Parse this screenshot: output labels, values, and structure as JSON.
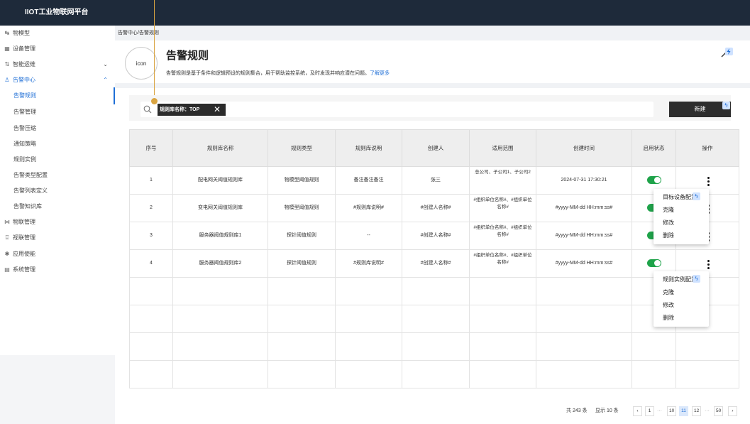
{
  "app": {
    "title": "IIOT工业物联网平台"
  },
  "sidebar": {
    "items": [
      {
        "icon": "model-icon",
        "glyph": "↹",
        "label": "物模型",
        "chevron": ""
      },
      {
        "icon": "device-icon",
        "glyph": "▦",
        "label": "设备管理",
        "chevron": ""
      },
      {
        "icon": "ops-icon",
        "glyph": "⇅",
        "label": "智能运维",
        "chevron": "⌄"
      },
      {
        "icon": "alarm-icon",
        "glyph": "♙",
        "label": "告警中心",
        "chevron": "⌃"
      },
      {
        "label": "告警规则",
        "sub": true
      },
      {
        "label": "告警管理",
        "sub": true
      },
      {
        "label": "告警压缩",
        "sub": true
      },
      {
        "label": "通知策略",
        "sub": true
      },
      {
        "label": "规则实例",
        "sub": true
      },
      {
        "label": "告警类型配置",
        "sub": true
      },
      {
        "label": "告警列表定义",
        "sub": true
      },
      {
        "label": "告警知识库",
        "sub": true
      },
      {
        "icon": "iot-icon",
        "glyph": "⋈",
        "label": "物联管理",
        "chevron": ""
      },
      {
        "icon": "video-icon",
        "glyph": "⍗",
        "label": "视联管理",
        "chevron": ""
      },
      {
        "icon": "app-icon",
        "glyph": "✱",
        "label": "应用使能",
        "chevron": ""
      },
      {
        "icon": "system-icon",
        "glyph": "▤",
        "label": "系统管理",
        "chevron": ""
      }
    ]
  },
  "breadcrumb": "告警中心/告警规则",
  "header": {
    "avatar": "icon",
    "title": "告警规则",
    "description": "告警规则是基于条件和逻辑预设的规则集合，用于帮助监控系统，及时发现并响应潜在问题。",
    "learn_more": "了解更多"
  },
  "filter": {
    "tag": "规则库名称：TOP",
    "tag_close": "✕",
    "new_button": "新建"
  },
  "table": {
    "headers": [
      "序号",
      "规则库名称",
      "规则类型",
      "规则库说明",
      "创建人",
      "适用范围",
      "创建时间",
      "启用状态",
      "操作"
    ],
    "rows": [
      [
        "1",
        "配电网关阈值规则库",
        "物模型阈值规则",
        "备注备注备注",
        "张三",
        "总公司、子公司1、子公司2",
        "2024-07-31 17:30:21"
      ],
      [
        "2",
        "变电网关阈值规则库",
        "物模型阈值规则",
        "#规则库说明#",
        "#创建人名称#",
        "#组织单位名称#、#组织单位名称#",
        "#yyyy-MM-dd HH:mm:ss#"
      ],
      [
        "3",
        "服务器阈值规则库1",
        "探针阈值规则",
        "--",
        "#创建人名称#",
        "#组织单位名称#、#组织单位名称#",
        "#yyyy-MM-dd HH:mm:ss#"
      ],
      [
        "4",
        "服务器阈值规则库2",
        "探针阈值规则",
        "#规则库说明#",
        "#创建人名称#",
        "#组织单位名称#、#组织单位名称#",
        "#yyyy-MM-dd HH:mm:ss#"
      ]
    ]
  },
  "menus": [
    {
      "items": [
        "目标设备配置",
        "克隆",
        "修改",
        "删除"
      ]
    },
    {
      "items": [
        "规则实例配置",
        "克隆",
        "修改",
        "删除"
      ]
    }
  ],
  "pager": {
    "total": "共 243 条",
    "page_size": "显示 10 条",
    "pages": [
      "1",
      "10",
      "11",
      "12",
      "50"
    ],
    "current": "11",
    "prev": "‹",
    "next": "›",
    "ellipsis": "···"
  },
  "colors": {
    "accent": "#1f6fd6",
    "topbar": "#1e2a3a",
    "toggle_on": "#1fa34a"
  }
}
